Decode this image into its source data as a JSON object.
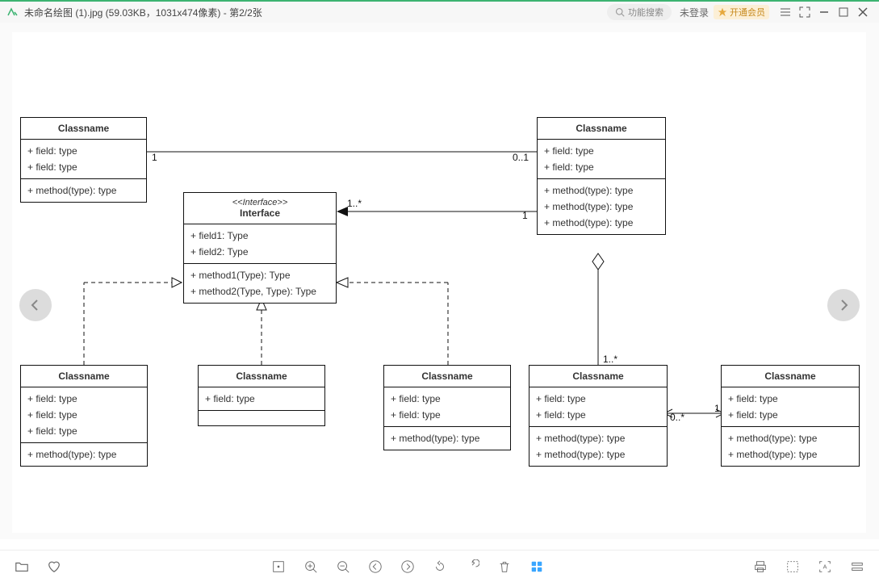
{
  "titlebar": {
    "filename": "未命名绘图 (1).jpg (59.03KB，1031x474像素) - 第2/2张",
    "search_placeholder": "功能搜索",
    "not_logged_in": "未登录",
    "vip": "开通会员"
  },
  "classes": {
    "c1": {
      "name": "Classname",
      "fields": [
        "+ field: type",
        "+ field: type"
      ],
      "methods": [
        "+ method(type): type"
      ]
    },
    "c2": {
      "name": "Classname",
      "fields": [
        "+ field: type",
        "+ field: type"
      ],
      "methods": [
        "+ method(type): type",
        "+ method(type): type",
        "+ method(type): type"
      ]
    },
    "c3": {
      "stereo": "<<Interface>>",
      "name": "Interface",
      "fields": [
        "+ field1: Type",
        "+ field2: Type"
      ],
      "methods": [
        "+ method1(Type): Type",
        "+ method2(Type, Type): Type"
      ]
    },
    "c4": {
      "name": "Classname",
      "fields": [
        "+ field: type",
        "+ field: type",
        "+ field: type"
      ],
      "methods": [
        "+ method(type): type"
      ]
    },
    "c5": {
      "name": "Classname",
      "fields": [
        "+ field: type"
      ],
      "methods": []
    },
    "c6": {
      "name": "Classname",
      "fields": [
        "+ field: type",
        "+ field: type"
      ],
      "methods": [
        "+ method(type): type"
      ]
    },
    "c7": {
      "name": "Classname",
      "fields": [
        "+ field: type",
        "+ field: type"
      ],
      "methods": [
        "+ method(type): type",
        "+ method(type): type"
      ]
    },
    "c8": {
      "name": "Classname",
      "fields": [
        "+ field: type",
        "+ field: type"
      ],
      "methods": [
        "+ method(type): type",
        "+ method(type): type"
      ]
    }
  },
  "mult": {
    "m1": "1",
    "m2": "0..1",
    "m3": "1..*",
    "m4": "1",
    "m5": "1..*",
    "m6": "0..*",
    "m7": "1"
  }
}
